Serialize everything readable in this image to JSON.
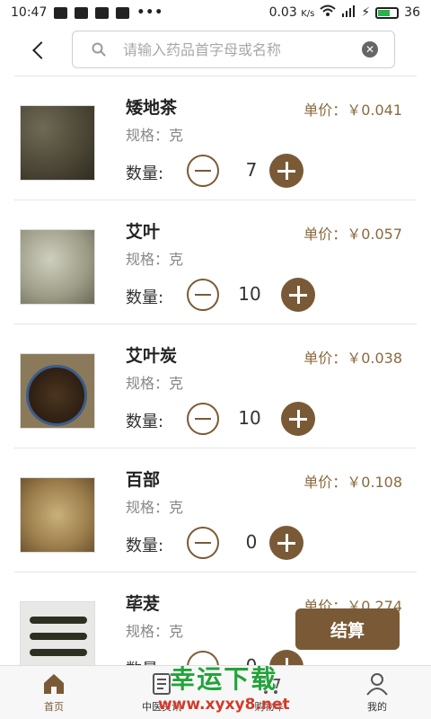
{
  "status": {
    "time": "10:47",
    "speed": "0.03",
    "speed_unit": "K/s",
    "battery": "36"
  },
  "search": {
    "placeholder": "请输入药品首字母或名称"
  },
  "items": [
    {
      "name": "矮地茶",
      "spec": "规格：克",
      "price": "单价：￥0.041",
      "qty_label": "数量:",
      "qty": "7"
    },
    {
      "name": "艾叶",
      "spec": "规格：克",
      "price": "单价：￥0.057",
      "qty_label": "数量:",
      "qty": "10"
    },
    {
      "name": "艾叶炭",
      "spec": "规格：克",
      "price": "单价：￥0.038",
      "qty_label": "数量:",
      "qty": "10"
    },
    {
      "name": "百部",
      "spec": "规格：克",
      "price": "单价：￥0.108",
      "qty_label": "数量:",
      "qty": "0"
    },
    {
      "name": "荜茇",
      "spec": "规格：克",
      "price": "单价：￥0.274",
      "qty_label": "数量:",
      "qty": "0"
    }
  ],
  "checkout_label": "结算",
  "tabs": [
    {
      "label": "首页",
      "icon": "home-icon",
      "active": true
    },
    {
      "label": "中医资讯",
      "icon": "news-icon"
    },
    {
      "label": "购物车",
      "icon": "cart-icon"
    },
    {
      "label": "我的",
      "icon": "user-icon"
    }
  ],
  "watermark": {
    "title": "幸运下载",
    "url": "www.xyxy8.net"
  },
  "colors": {
    "accent": "#7a5a36",
    "price": "#8b6a3e",
    "watermark_green": "#23a33a",
    "watermark_red": "#d23a2a"
  }
}
